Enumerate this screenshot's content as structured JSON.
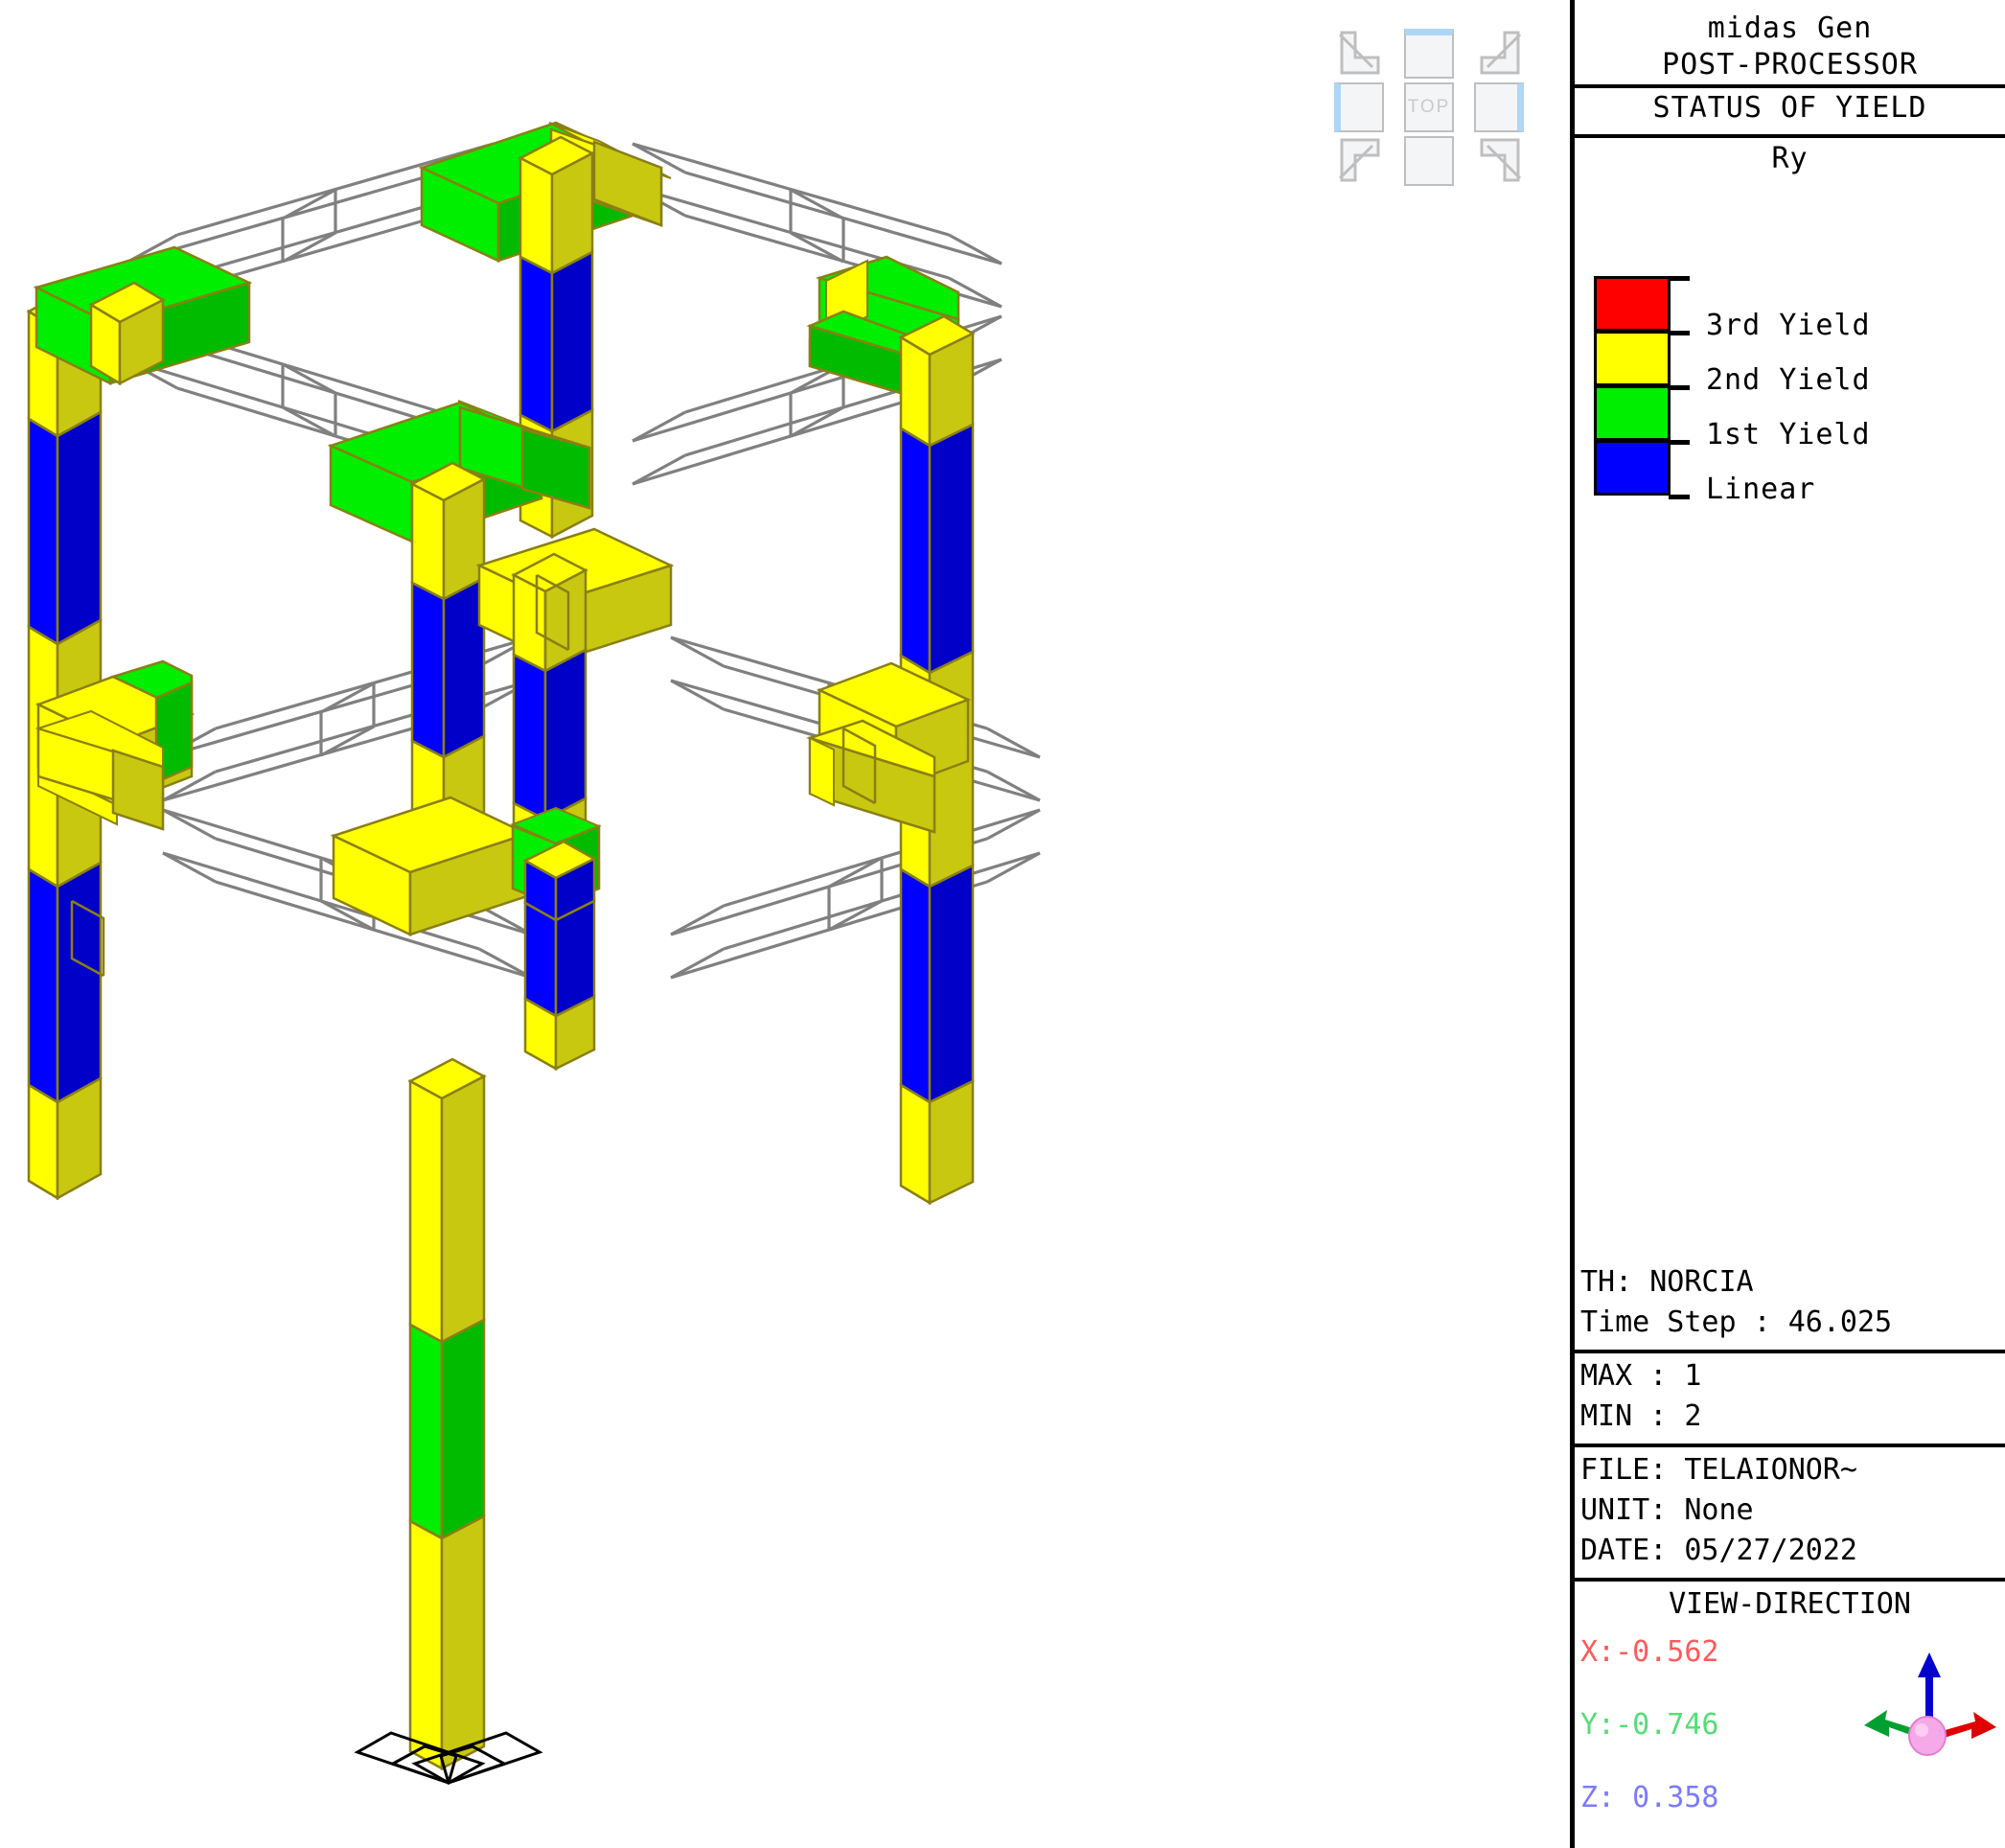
{
  "app": {
    "title_line1": "midas Gen",
    "title_line2": "POST-PROCESSOR",
    "result_title": "STATUS OF YIELD",
    "component": "Ry"
  },
  "viewcube": {
    "center_label": "TOP",
    "corner_icons": [
      "arrow-down-right-icon",
      "arrow-down-left-icon",
      "arrow-up-right-icon",
      "arrow-up-left-icon"
    ],
    "edge_cells": [
      "top-face",
      "left-face",
      "right-face",
      "bottom-face"
    ],
    "highlight_color": "#aed6f5"
  },
  "legend": {
    "entries": [
      {
        "label": "3rd Yield",
        "color": "#ff0000",
        "name": "3rd-yield"
      },
      {
        "label": "2nd Yield",
        "color": "#ffff00",
        "name": "2nd-yield"
      },
      {
        "label": "1st Yield",
        "color": "#00ee00",
        "name": "1st-yield"
      },
      {
        "label": "Linear",
        "color": "#0000ff",
        "name": "linear"
      }
    ]
  },
  "info": {
    "th_label": "TH: NORCIA",
    "time_step": "Time Step : 46.025",
    "max": "MAX : 1",
    "min": "MIN : 2",
    "file": "FILE: TELAIONOR~",
    "unit": "UNIT: None",
    "date": "DATE: 05/27/2022"
  },
  "view_direction": {
    "heading": "VIEW-DIRECTION",
    "x": "X:-0.562",
    "y": "Y:-0.746",
    "z": "Z: 0.358",
    "x_color": "#ff5a5a",
    "y_color": "#55dd77",
    "z_color": "#7b7bff"
  },
  "model": {
    "name": "3d-frame-yield-plot",
    "support_symbol": "fixed-support-icon",
    "wireframe_color": "#808080",
    "edge_color": "#8a7f14",
    "shade_factor": 0.78
  },
  "chart_data": {
    "type": "diagram",
    "title": "STATUS OF YIELD - Ry",
    "colors": {
      "3rd Yield": "#ff0000",
      "2nd Yield": "#ffff00",
      "1st Yield": "#00ee00",
      "Linear": "#0000ff"
    },
    "notes": "Two-storey 3D frame; members colour-coded by yield status at time step 46.025 of TH NORCIA."
  }
}
